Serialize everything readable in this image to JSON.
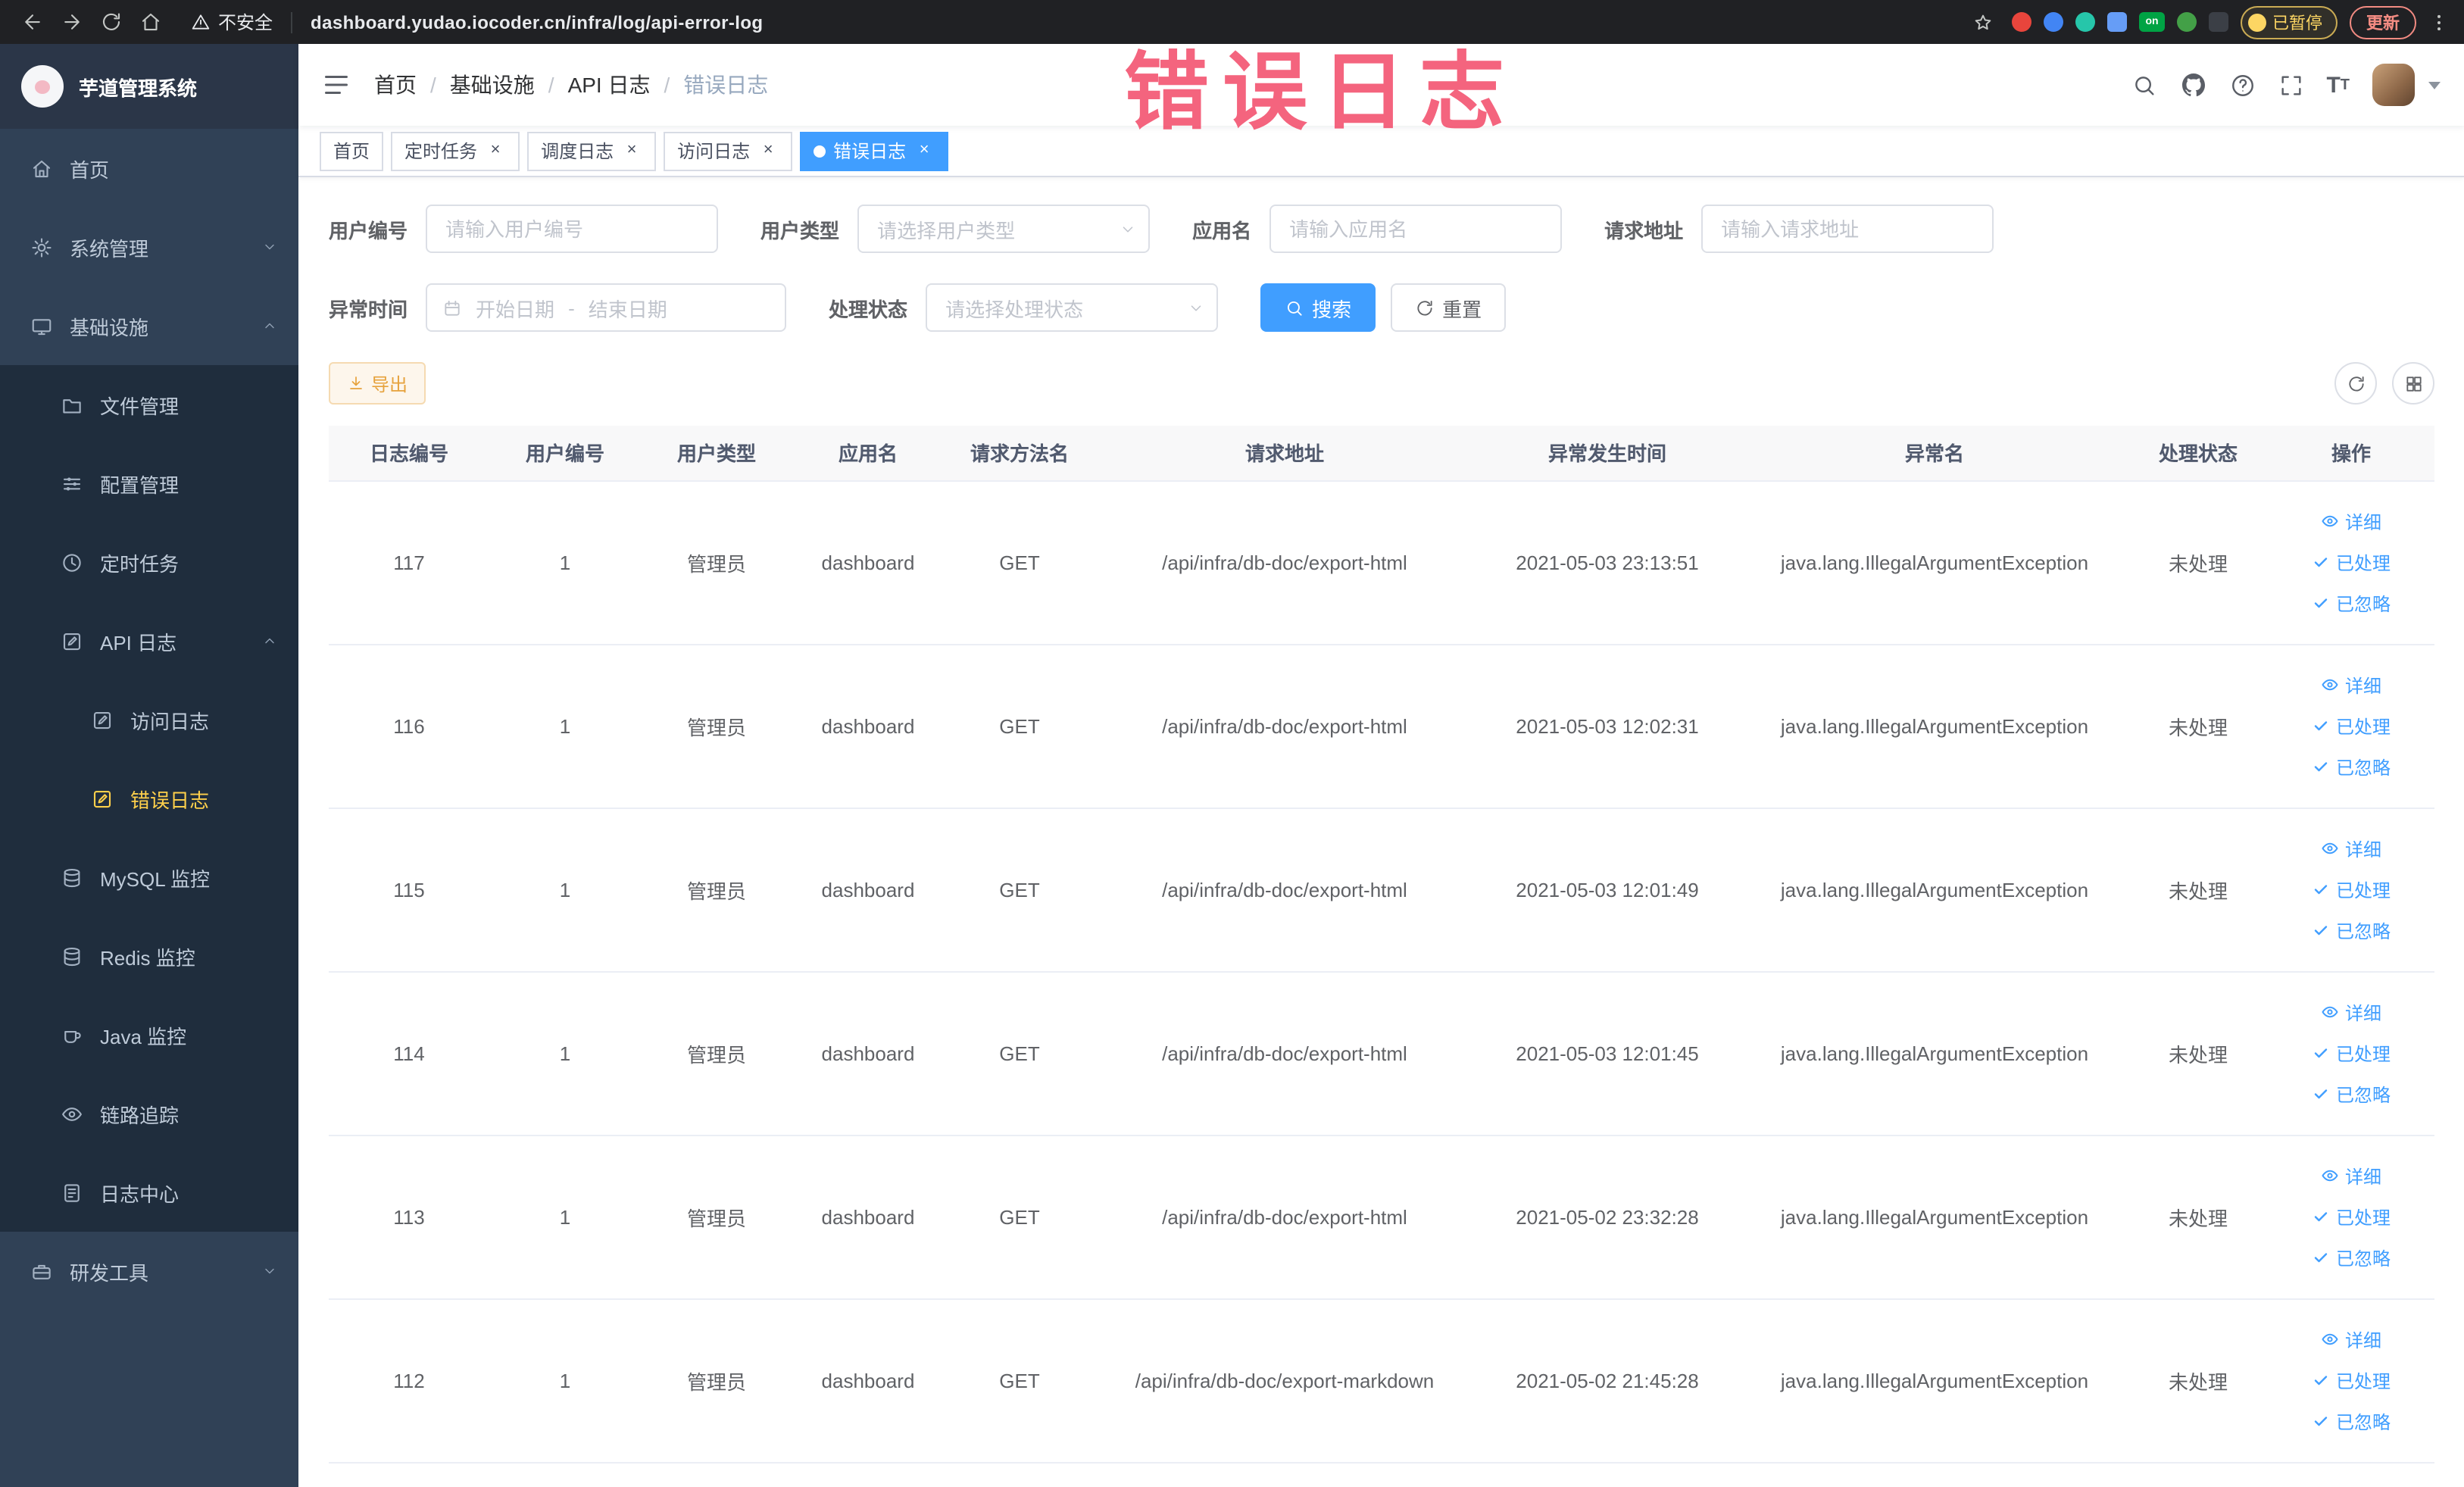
{
  "browser": {
    "security_label": "不安全",
    "url": "dashboard.yudao.iocoder.cn/infra/log/api-error-log",
    "extension_on_badge": "on",
    "paused_badge": "已暂停",
    "update_button": "更新"
  },
  "annotation": {
    "text": "错误日志"
  },
  "sidebar": {
    "logo_title": "芋道管理系统",
    "items": [
      {
        "label": "首页"
      },
      {
        "label": "系统管理"
      },
      {
        "label": "基础设施"
      },
      {
        "label": "文件管理"
      },
      {
        "label": "配置管理"
      },
      {
        "label": "定时任务"
      },
      {
        "label": "API 日志"
      },
      {
        "label": "访问日志"
      },
      {
        "label": "错误日志"
      },
      {
        "label": "MySQL 监控"
      },
      {
        "label": "Redis 监控"
      },
      {
        "label": "Java 监控"
      },
      {
        "label": "链路追踪"
      },
      {
        "label": "日志中心"
      },
      {
        "label": "研发工具"
      }
    ]
  },
  "breadcrumb": {
    "items": [
      "首页",
      "基础设施",
      "API 日志",
      "错误日志"
    ]
  },
  "tabs": [
    {
      "label": "首页"
    },
    {
      "label": "定时任务"
    },
    {
      "label": "调度日志"
    },
    {
      "label": "访问日志"
    },
    {
      "label": "错误日志"
    }
  ],
  "filters": {
    "user_id_label": "用户编号",
    "user_id_placeholder": "请输入用户编号",
    "user_type_label": "用户类型",
    "user_type_placeholder": "请选择用户类型",
    "app_name_label": "应用名",
    "app_name_placeholder": "请输入应用名",
    "request_url_label": "请求地址",
    "request_url_placeholder": "请输入请求地址",
    "time_label": "异常时间",
    "time_start_placeholder": "开始日期",
    "time_separator": "-",
    "time_end_placeholder": "结束日期",
    "status_label": "处理状态",
    "status_placeholder": "请选择处理状态",
    "search_button": "搜索",
    "reset_button": "重置"
  },
  "toolbar": {
    "export_button": "导出"
  },
  "table": {
    "columns": [
      "日志编号",
      "用户编号",
      "用户类型",
      "应用名",
      "请求方法名",
      "请求地址",
      "异常发生时间",
      "异常名",
      "处理状态",
      "操作"
    ],
    "actions": [
      "详细",
      "已处理",
      "已忽略"
    ],
    "rows": [
      {
        "log_id": "117",
        "user_id": "1",
        "user_type": "管理员",
        "app_name": "dashboard",
        "method": "GET",
        "url": "/api/infra/db-doc/export-html",
        "time": "2021-05-03 23:13:51",
        "exception": "java.lang.IllegalArgumentException",
        "status": "未处理"
      },
      {
        "log_id": "116",
        "user_id": "1",
        "user_type": "管理员",
        "app_name": "dashboard",
        "method": "GET",
        "url": "/api/infra/db-doc/export-html",
        "time": "2021-05-03 12:02:31",
        "exception": "java.lang.IllegalArgumentException",
        "status": "未处理"
      },
      {
        "log_id": "115",
        "user_id": "1",
        "user_type": "管理员",
        "app_name": "dashboard",
        "method": "GET",
        "url": "/api/infra/db-doc/export-html",
        "time": "2021-05-03 12:01:49",
        "exception": "java.lang.IllegalArgumentException",
        "status": "未处理"
      },
      {
        "log_id": "114",
        "user_id": "1",
        "user_type": "管理员",
        "app_name": "dashboard",
        "method": "GET",
        "url": "/api/infra/db-doc/export-html",
        "time": "2021-05-03 12:01:45",
        "exception": "java.lang.IllegalArgumentException",
        "status": "未处理"
      },
      {
        "log_id": "113",
        "user_id": "1",
        "user_type": "管理员",
        "app_name": "dashboard",
        "method": "GET",
        "url": "/api/infra/db-doc/export-html",
        "time": "2021-05-02 23:32:28",
        "exception": "java.lang.IllegalArgumentException",
        "status": "未处理"
      },
      {
        "log_id": "112",
        "user_id": "1",
        "user_type": "管理员",
        "app_name": "dashboard",
        "method": "GET",
        "url": "/api/infra/db-doc/export-markdown",
        "time": "2021-05-02 21:45:28",
        "exception": "java.lang.IllegalArgumentException",
        "status": "未处理"
      }
    ]
  },
  "colors": {
    "accent": "#409eff",
    "sidebar_bg": "#304156",
    "submenu_bg": "#1f2d3d",
    "active_menu_text": "#ffd04b",
    "warning": "#e6a23c",
    "annotation": "#f24261"
  }
}
